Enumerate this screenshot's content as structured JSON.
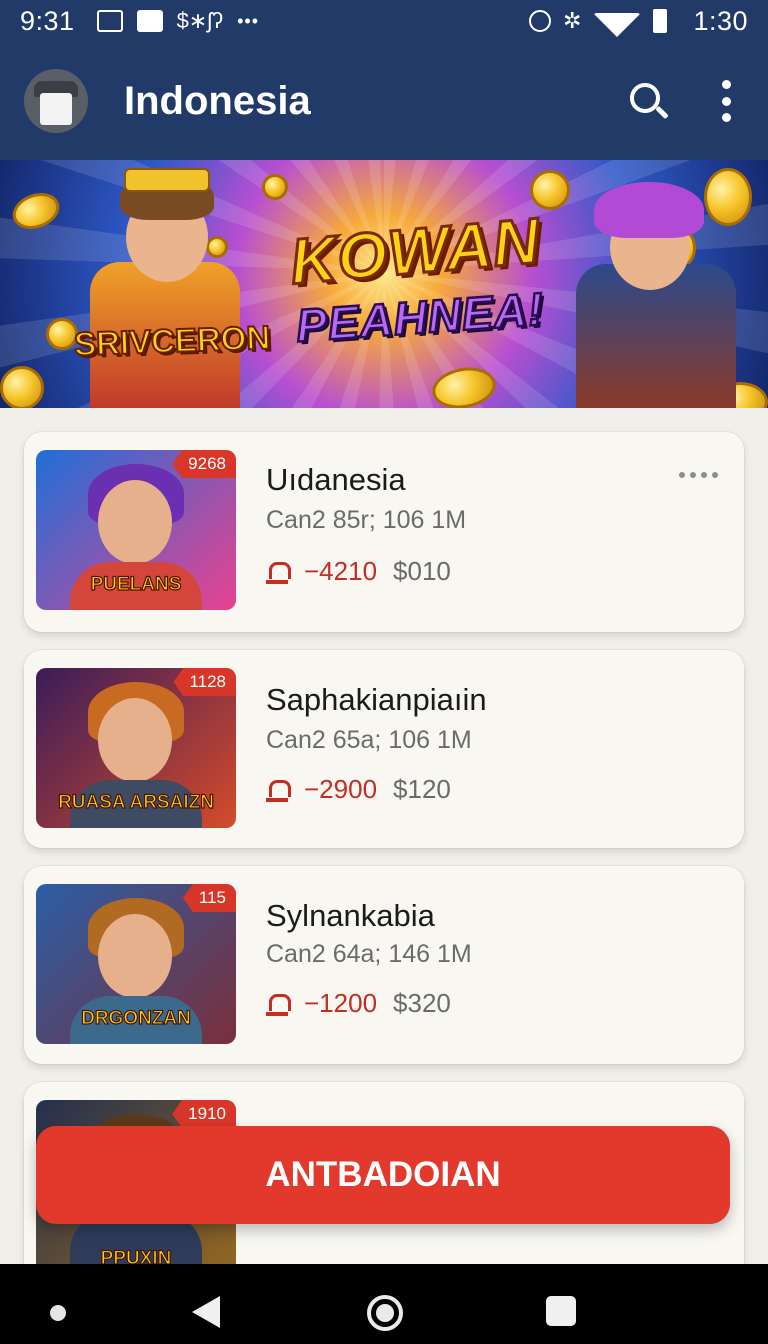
{
  "status_bar": {
    "time_left": "9:31",
    "signal_text": "$∗ʃʔ",
    "time_right": "1:30",
    "icons": [
      "image-icon",
      "chart-icon",
      "alarm-icon",
      "bluetooth-icon",
      "wifi-icon",
      "battery-icon"
    ]
  },
  "app_bar": {
    "title": "Indonesia",
    "icons": [
      "search-icon",
      "more-vert-icon"
    ]
  },
  "banner": {
    "title_main": "KOWAN",
    "title_sub": "PEAHNEA!",
    "left_label": "SRIVCERON"
  },
  "games": [
    {
      "badge": "9268",
      "title": "Uıdanesia",
      "meta": "Can2 85r;  106 1M",
      "delta": "−4210",
      "price": "$010",
      "thumb_label": "PUELANS",
      "colors": {
        "bg1": "#1f6fd8",
        "bg2": "#e9428f",
        "hair": "#6b2fb1",
        "body": "#d4453b"
      }
    },
    {
      "badge": "1128",
      "title": "Saphakianpiaıin",
      "meta": "Can2 65a;  106 1M",
      "delta": "−2900",
      "price": "$120",
      "thumb_label": "RUASA ARSAIZN",
      "colors": {
        "bg1": "#3a1c5a",
        "bg2": "#d64b2a",
        "hair": "#c86a22",
        "body": "#3f4a63"
      }
    },
    {
      "badge": "115",
      "title": "Sylnankabia",
      "meta": "Can2 64a;  146 1M",
      "delta": "−1200",
      "price": "$320",
      "thumb_label": "DRGONZAN",
      "colors": {
        "bg1": "#2a5ea6",
        "bg2": "#7a2f3a",
        "hair": "#b06a22",
        "body": "#3c6a8d"
      }
    },
    {
      "badge": "1910",
      "title": "",
      "meta": "",
      "delta": "",
      "price": "",
      "thumb_label": "PPUXIN",
      "colors": {
        "bg1": "#23304f",
        "bg2": "#9a6a1f",
        "hair": "#5a3a1d",
        "body": "#2e3c5a"
      }
    }
  ],
  "cta": {
    "label": "ANTBADOIAN"
  },
  "nav_bar": {
    "icons": [
      "nav-dot-icon",
      "back-icon",
      "home-icon",
      "recents-icon"
    ]
  },
  "theme": {
    "header_bg": "#223a68",
    "accent": "#e2392c",
    "negative": "#c62d22"
  }
}
